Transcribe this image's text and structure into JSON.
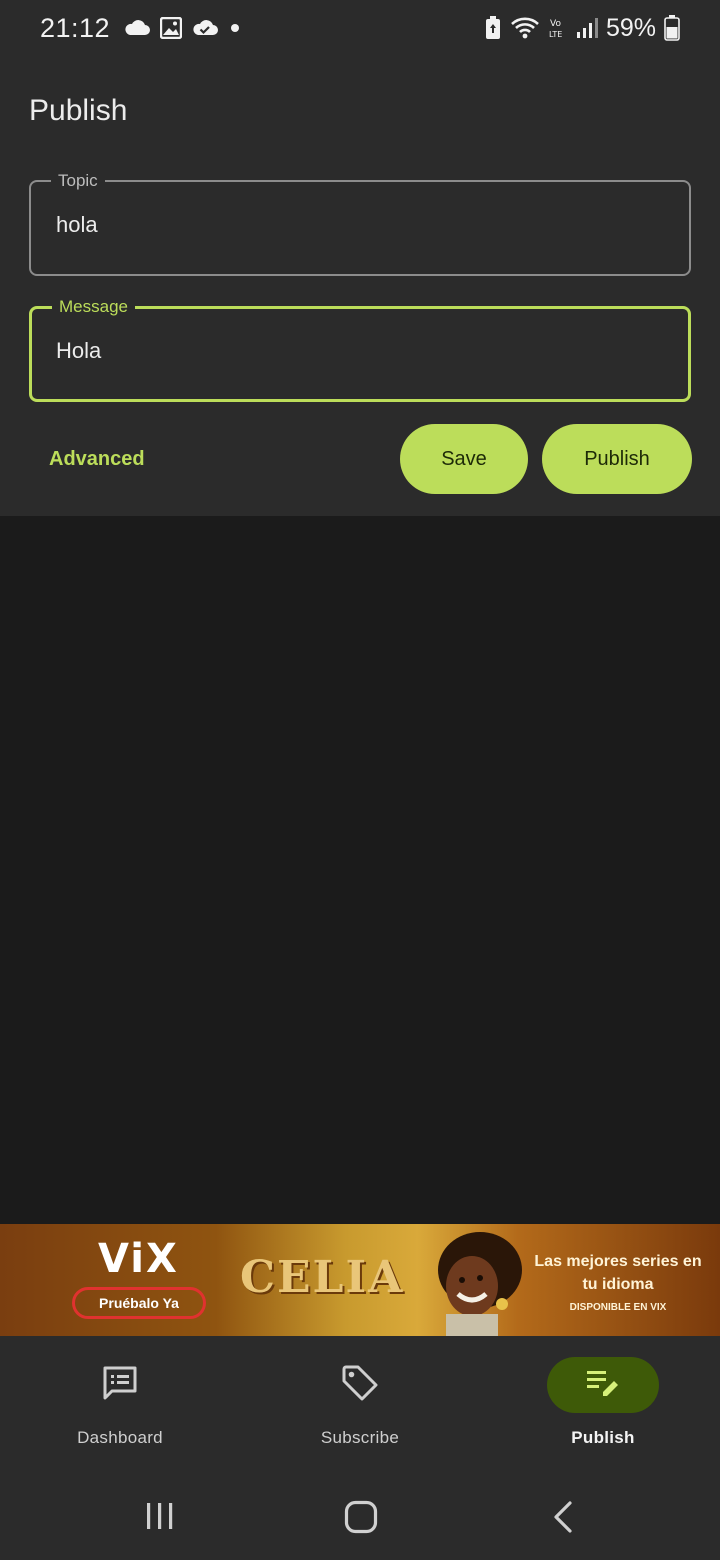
{
  "status_bar": {
    "time": "21:12",
    "battery_percent": "59%",
    "left_icons": [
      "cloud-icon",
      "image-icon",
      "cloud-check-icon",
      "dot-icon"
    ],
    "right_icons": [
      "battery-saver-icon",
      "wifi-icon",
      "volte-icon",
      "signal-icon",
      "battery-icon"
    ]
  },
  "page": {
    "title": "Publish"
  },
  "form": {
    "topic": {
      "label": "Topic",
      "value": "hola"
    },
    "message": {
      "label": "Message",
      "value": "Hola"
    },
    "advanced_label": "Advanced",
    "save_label": "Save",
    "publish_label": "Publish"
  },
  "ad": {
    "brand": "ViX",
    "cta": "Pruébalo Ya",
    "show_title": "CELIA",
    "tagline": "Las mejores series en tu idioma",
    "availability": "DISPONIBLE EN VIX"
  },
  "bottom_nav": {
    "items": [
      {
        "label": "Dashboard",
        "icon": "dashboard-icon",
        "active": false
      },
      {
        "label": "Subscribe",
        "icon": "tag-icon",
        "active": false
      },
      {
        "label": "Publish",
        "icon": "publish-icon",
        "active": true
      }
    ]
  },
  "system_nav": {
    "buttons": [
      "recents-icon",
      "home-icon",
      "back-icon"
    ]
  },
  "colors": {
    "accent": "#bcdd5a",
    "active_nav_bg": "#3e5a08",
    "panel_bg": "#2b2b2b",
    "body_bg": "#1b1b1b"
  }
}
